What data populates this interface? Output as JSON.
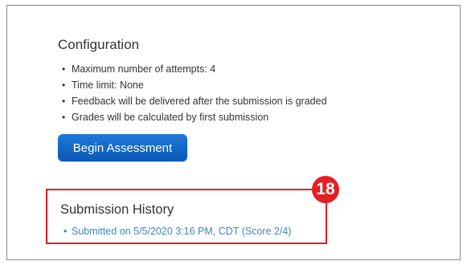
{
  "configuration": {
    "title": "Configuration",
    "items": [
      "Maximum number of attempts: 4",
      "Time limit: None",
      "Feedback will be delivered after the submission is graded",
      "Grades will be calculated by first submission"
    ]
  },
  "begin_button": {
    "label": "Begin Assessment"
  },
  "submission_history": {
    "title": "Submission History",
    "entries": [
      "Submitted on 5/5/2020 3:16 PM, CDT (Score 2/4)"
    ]
  },
  "annotation": {
    "step_number": "18",
    "color": "#e31e24"
  },
  "colors": {
    "button": "#1168c9",
    "link": "#3a86c8",
    "highlight": "#e31e24"
  }
}
